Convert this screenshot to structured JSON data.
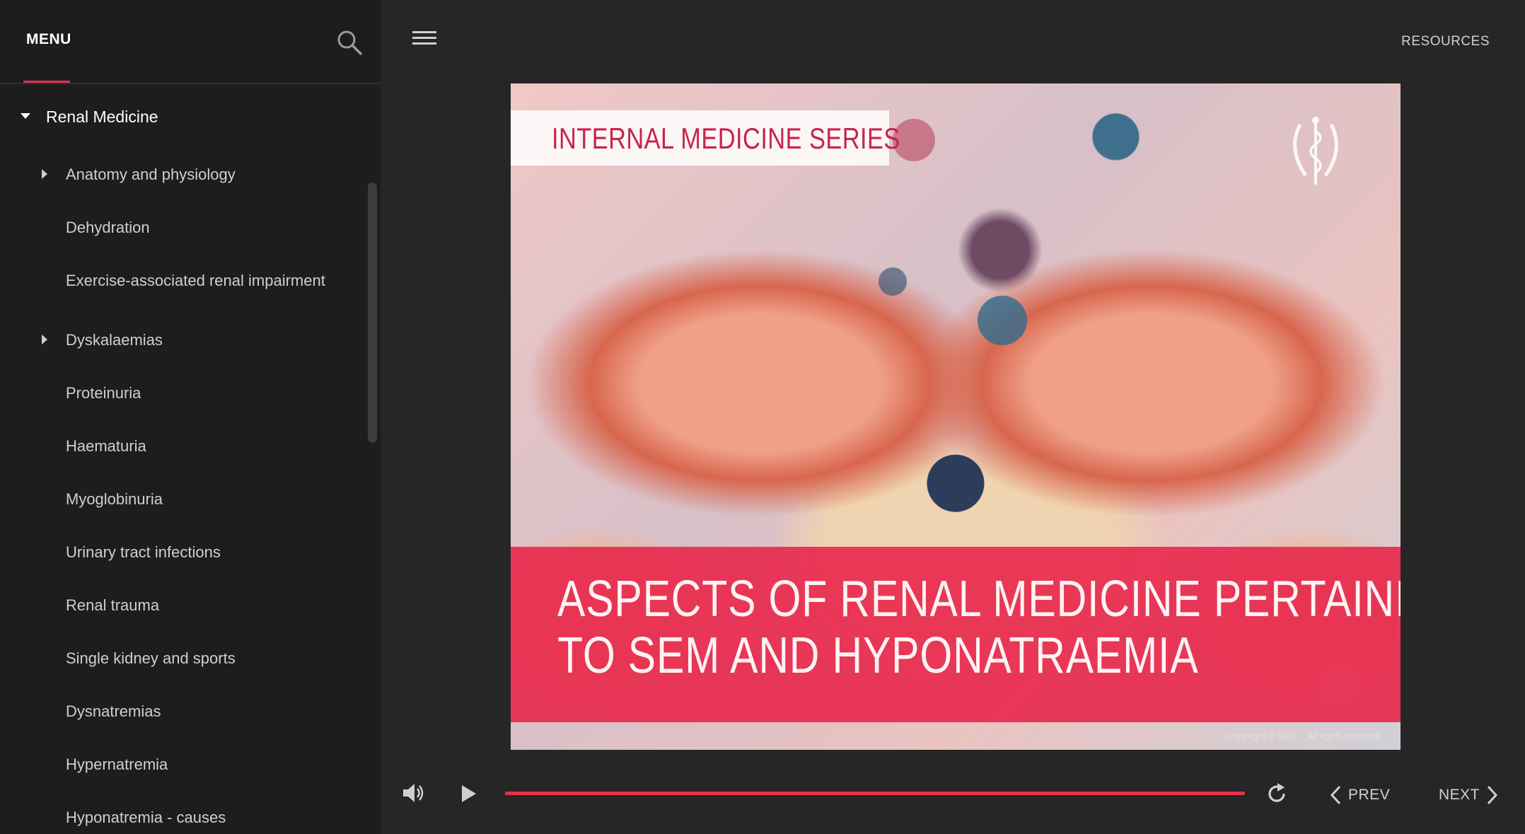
{
  "sidebar": {
    "menu_title": "MENU",
    "root": {
      "label": "Renal Medicine"
    },
    "items": [
      {
        "label": "Anatomy and physiology",
        "expandable": true
      },
      {
        "label": "Dehydration",
        "expandable": false
      },
      {
        "label": "Exercise-associated renal impairment",
        "expandable": false
      },
      {
        "label": "Dyskalaemias",
        "expandable": true
      },
      {
        "label": "Proteinuria",
        "expandable": false
      },
      {
        "label": "Haematuria",
        "expandable": false
      },
      {
        "label": "Myoglobinuria",
        "expandable": false
      },
      {
        "label": "Urinary tract infections",
        "expandable": false
      },
      {
        "label": "Renal trauma",
        "expandable": false
      },
      {
        "label": "Single kidney and sports",
        "expandable": false
      },
      {
        "label": "Dysnatremias",
        "expandable": false
      },
      {
        "label": "Hypernatremia",
        "expandable": false
      },
      {
        "label": "Hyponatremia - causes",
        "expandable": false
      }
    ]
  },
  "header": {
    "resources_label": "RESOURCES"
  },
  "slide": {
    "series_label": "INTERNAL MEDICINE SERIES",
    "title_line1": "ASPECTS OF RENAL MEDICINE PERTAINING",
    "title_line2": "TO SEM AND HYPONATRAEMIA",
    "copyright": "Copyright © SEM... All rights reserved"
  },
  "controls": {
    "prev_label": "PREV",
    "next_label": "NEXT",
    "progress": 1.0
  },
  "colors": {
    "accent": "#e8304f",
    "sidebar_bg": "#1d1d1d",
    "main_bg": "#262626"
  }
}
